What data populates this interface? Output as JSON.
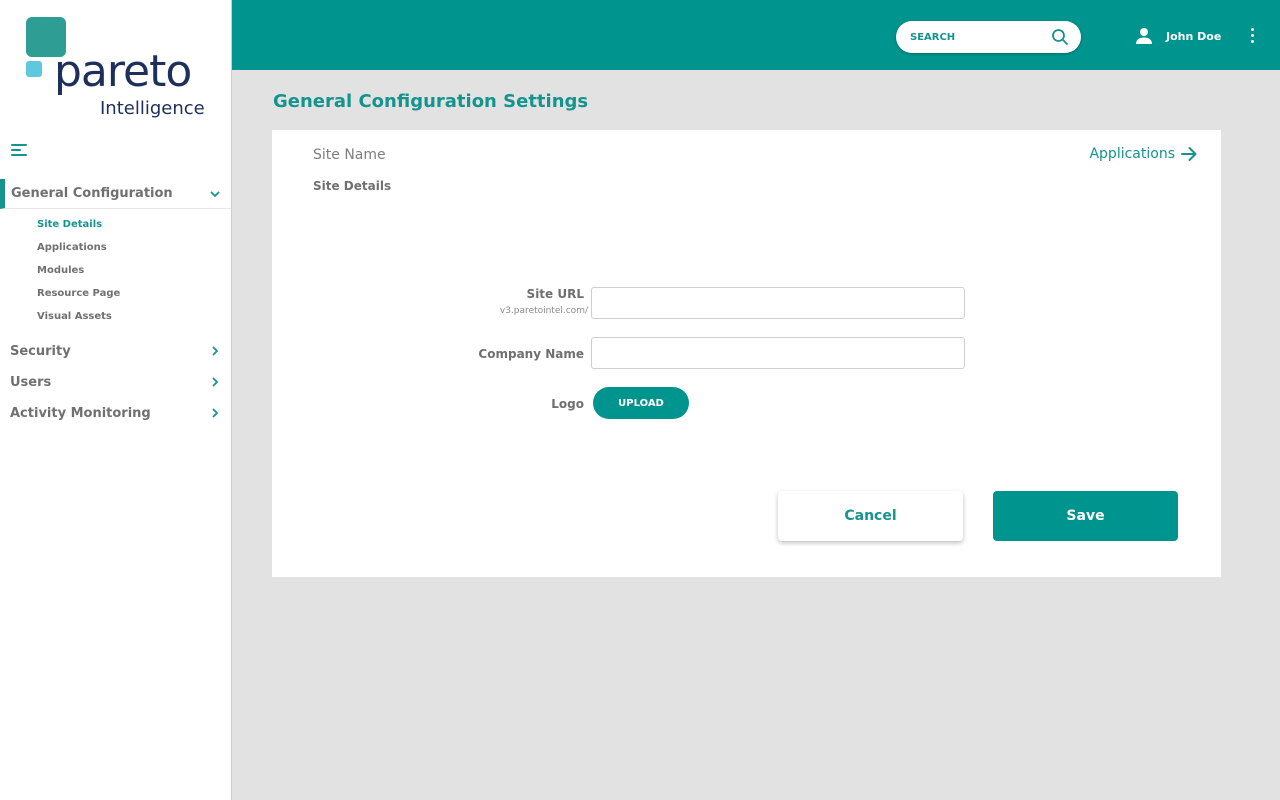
{
  "brand": {
    "name": "pareto",
    "tagline": "Intelligence"
  },
  "header": {
    "search_placeholder": "SEARCH",
    "user_name": "John Doe"
  },
  "sidebar": {
    "groups": [
      {
        "label": "General Configuration",
        "expanded": true,
        "items": [
          {
            "label": "Site Details",
            "active": true
          },
          {
            "label": "Applications"
          },
          {
            "label": "Modules"
          },
          {
            "label": "Resource Page"
          },
          {
            "label": "Visual Assets"
          }
        ]
      },
      {
        "label": "Security",
        "expanded": false
      },
      {
        "label": "Users",
        "expanded": false
      },
      {
        "label": "Activity Monitoring",
        "expanded": false
      }
    ]
  },
  "main": {
    "title": "General Configuration Settings",
    "site_name": "Site Name",
    "section": "Site Details",
    "apps_link": "Applications",
    "form": {
      "site_url_label": "Site URL",
      "site_url_hint": "v3.paretointel.com/",
      "site_url_value": "",
      "company_name_label": "Company Name",
      "company_name_value": "",
      "logo_label": "Logo",
      "upload_label": "UPLOAD"
    },
    "actions": {
      "cancel": "Cancel",
      "save": "Save"
    }
  },
  "colors": {
    "accent": "#00948e",
    "accent_text": "#15948e",
    "brand_navy": "#1d2f5a",
    "brand_teal": "#2e9e95",
    "brand_cyan": "#5ec9dc",
    "background": "#e2e2e2"
  },
  "icons": {
    "search": "search-icon",
    "user": "user-icon",
    "menu": "hamburger-icon",
    "more": "kebab-icon",
    "arrow": "arrow-right-icon",
    "chevron_down": "chevron-down-icon",
    "chevron_right": "chevron-right-icon"
  }
}
